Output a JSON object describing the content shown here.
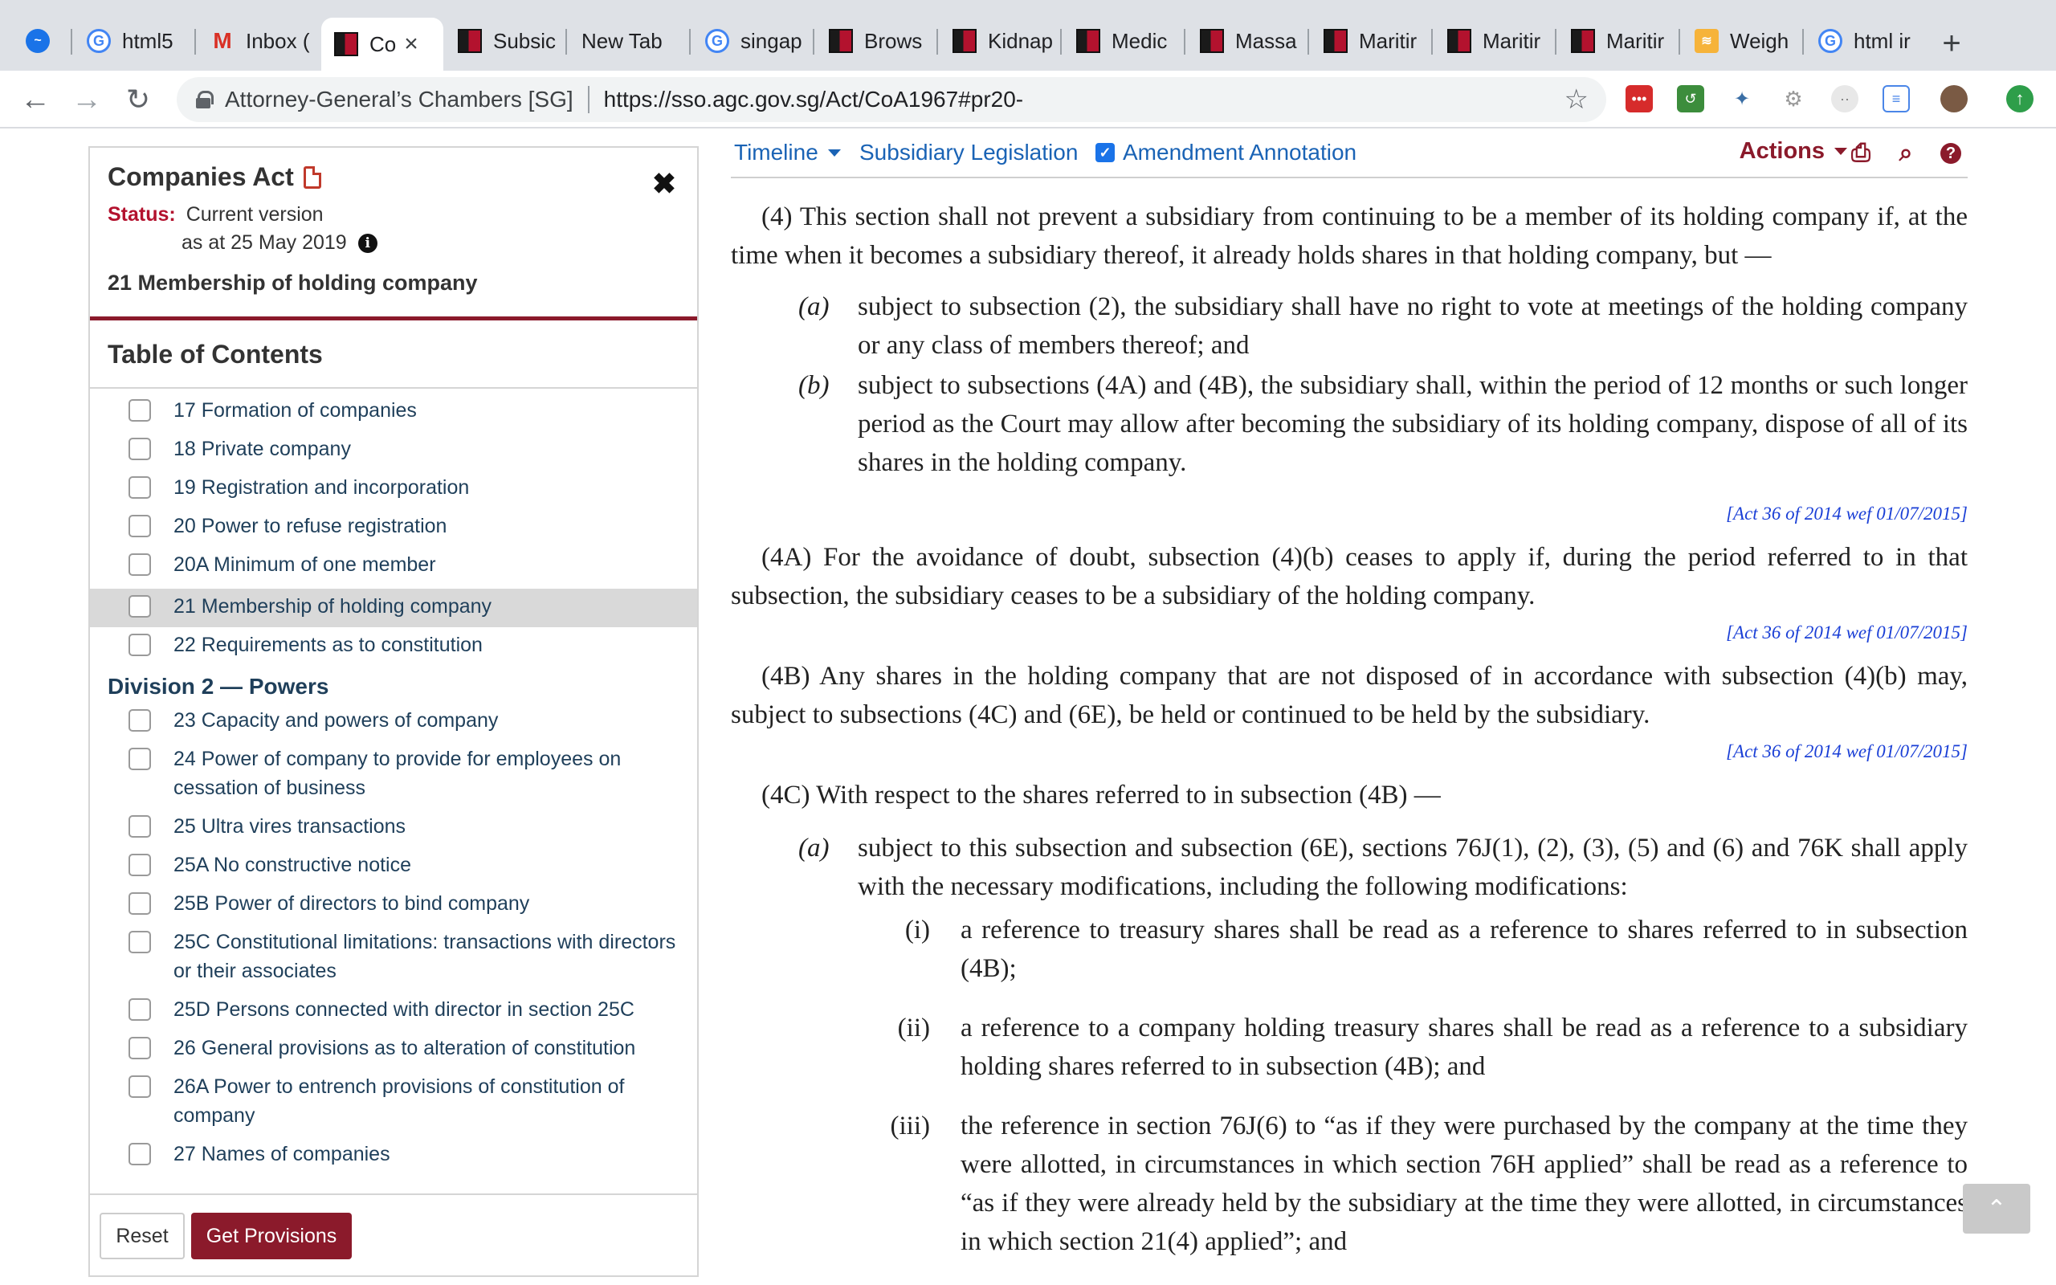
{
  "browser": {
    "tabs": [
      {
        "label": "",
        "icon": "messenger-icon"
      },
      {
        "label": "html5",
        "icon": "google-icon"
      },
      {
        "label": "Inbox (",
        "icon": "gmail-icon"
      },
      {
        "label": "Co",
        "icon": "agc-icon",
        "active": true
      },
      {
        "label": "Subsic",
        "icon": "agc-icon"
      },
      {
        "label": "New Tab",
        "icon": ""
      },
      {
        "label": "singap",
        "icon": "google-icon"
      },
      {
        "label": "Brows",
        "icon": "agc-icon"
      },
      {
        "label": "Kidnap",
        "icon": "agc-icon"
      },
      {
        "label": "Medic",
        "icon": "agc-icon"
      },
      {
        "label": "Massa",
        "icon": "agc-icon"
      },
      {
        "label": "Maritir",
        "icon": "agc-icon"
      },
      {
        "label": "Maritir",
        "icon": "agc-icon"
      },
      {
        "label": "Maritir",
        "icon": "agc-icon"
      },
      {
        "label": "Weigh",
        "icon": "weigh-icon"
      },
      {
        "label": "html ir",
        "icon": "google-icon"
      }
    ],
    "new_tab": "+",
    "close_glyph": "×",
    "site_name": "Attorney-General’s Chambers [SG]",
    "url": "https://sso.agc.gov.sg/Act/CoA1967#pr20-"
  },
  "panel": {
    "title": "Companies Act",
    "status_label": "Status:",
    "status_value": "Current version",
    "as_at": "as at 25 May 2019",
    "current_section": "21 Membership of holding company",
    "toc_heading": "Table of Contents",
    "toc_items_a": [
      "17 Formation of companies",
      "18 Private company",
      "19 Registration and incorporation",
      "20 Power to refuse registration",
      "20A Minimum of one member",
      "21 Membership of holding company",
      "22 Requirements as to constitution"
    ],
    "division": "Division 2 — Powers",
    "toc_items_b": [
      "23 Capacity and powers of company",
      "24 Power of company to provide for employees on cessation of business",
      "25 Ultra vires transactions",
      "25A No constructive notice",
      "25B Power of directors to bind company",
      "25C Constitutional limitations: transactions with directors or their associates",
      "25D Persons connected with director in section 25C",
      "26 General provisions as to alteration of constitution",
      "26A Power to entrench provisions of constitution of company",
      "27 Names of companies"
    ],
    "reset_label": "Reset",
    "get_label": "Get Provisions"
  },
  "mainbar": {
    "timeline": "Timeline",
    "subsidiary": "Subsidiary Legislation",
    "amendment": "Amendment Annotation",
    "actions": "Actions"
  },
  "content": {
    "p4": "(4)  This section shall not prevent a subsidiary from continuing to be a member of its holding company if, at the time when it becomes a subsidiary thereof, it already holds shares in that holding company, but —",
    "p4a_lbl": "(a)",
    "p4a": "subject to subsection (2), the subsidiary shall have no right to vote at meetings of the holding company or any class of members thereof; and",
    "p4b_lbl": "(b)",
    "p4b": "subject to subsections (4A) and (4B), the subsidiary shall, within the period of 12 months or such longer period as the Court may allow after becoming the subsidiary of its holding company, dispose of all of its shares in the holding company.",
    "amend1": "[Act 36 of 2014 wef 01/07/2015]",
    "p4A": "(4A)  For the avoidance of doubt, subsection (4)(b) ceases to apply if, during the period referred to in that subsection, the subsidiary ceases to be a subsidiary of the holding company.",
    "amend2": "[Act 36 of 2014 wef 01/07/2015]",
    "p4B": "(4B)  Any shares in the holding company that are not disposed of in accordance with subsection (4)(b) may, subject to subsections (4C) and (6E), be held or continued to be held by the subsidiary.",
    "amend3": "[Act 36 of 2014 wef 01/07/2015]",
    "p4C": "(4C)  With respect to the shares referred to in subsection (4B) —",
    "p4Ca_lbl": "(a)",
    "p4Ca": "subject to this subsection and subsection (6E), sections 76J(1), (2), (3), (5) and (6) and 76K shall apply with the necessary modifications, including the following modifications:",
    "i_lbl": "(i)",
    "i": "a reference to treasury shares shall be read as a reference to shares referred to in subsection (4B);",
    "ii_lbl": "(ii)",
    "ii": "a reference to a company holding treasury shares shall be read as a reference to a subsidiary holding shares referred to in subsection (4B); and",
    "iii_lbl": "(iii)",
    "iii": "the reference in section 76J(6) to “as if they were purchased by the company at the time they were allotted, in circumstances in which section 76H applied” shall be read as a reference to “as if they were already held by the subsidiary at the time they were allotted, in circumstances in which section 21(4) applied”; and"
  },
  "colors": {
    "brand": "#8b1a2b",
    "link": "#1a63b5",
    "annotation": "#1a3fd6"
  }
}
